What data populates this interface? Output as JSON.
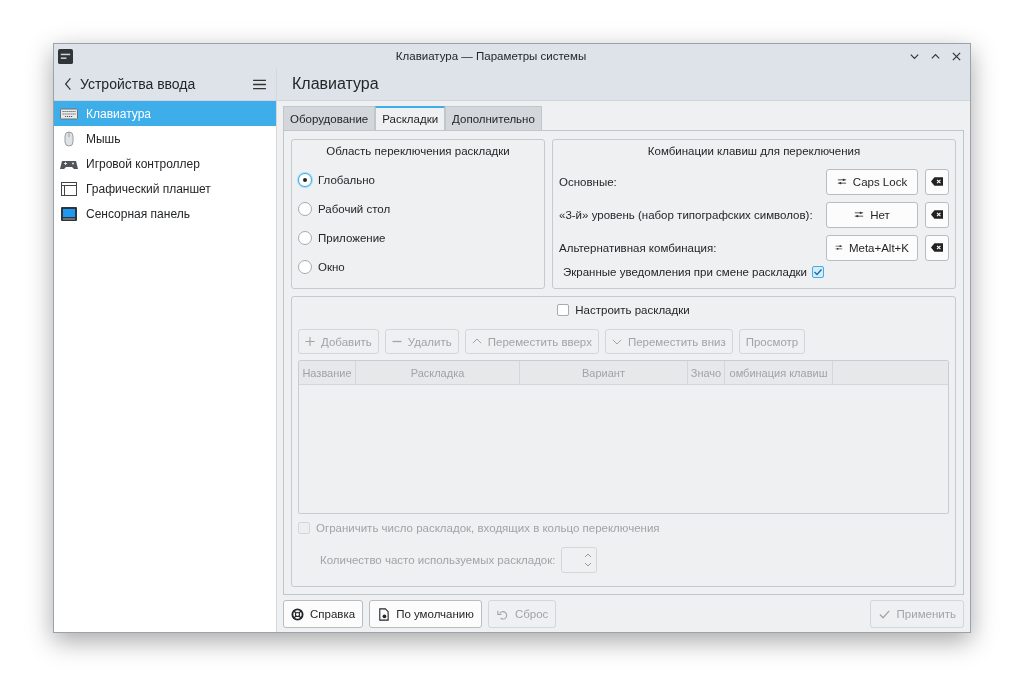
{
  "window": {
    "title": "Клавиатура — Параметры системы"
  },
  "sidebar": {
    "title": "Устройства ввода",
    "items": [
      {
        "label": "Клавиатура",
        "kind": "keyboard",
        "selected": true
      },
      {
        "label": "Мышь",
        "kind": "mouse",
        "selected": false
      },
      {
        "label": "Игровой контроллер",
        "kind": "gamepad",
        "selected": false
      },
      {
        "label": "Графический планшет",
        "kind": "tablet",
        "selected": false
      },
      {
        "label": "Сенсорная панель",
        "kind": "touchpad",
        "selected": false
      }
    ]
  },
  "page_title": "Клавиатура",
  "tabs": [
    {
      "label": "Оборудование",
      "selected": false
    },
    {
      "label": "Раскладки",
      "selected": true
    },
    {
      "label": "Дополнительно",
      "selected": false
    }
  ],
  "switching_area": {
    "title": "Область переключения раскладки",
    "options": [
      {
        "label": "Глобально",
        "selected": true
      },
      {
        "label": "Рабочий стол",
        "selected": false
      },
      {
        "label": "Приложение",
        "selected": false
      },
      {
        "label": "Окно",
        "selected": false
      }
    ]
  },
  "shortcuts": {
    "title": "Комбинации клавиш для переключения",
    "rows": [
      {
        "label": "Основные:",
        "value": "Caps Lock"
      },
      {
        "label": "«3-й» уровень (набор типографских символов):",
        "value": "Нет"
      },
      {
        "label": "Альтернативная комбинация:",
        "value": "Meta+Alt+K"
      }
    ],
    "osd": {
      "label": "Экранные уведомления при смене раскладки",
      "checked": true
    }
  },
  "layouts": {
    "configure": {
      "label": "Настроить раскладки",
      "checked": false
    },
    "buttons": [
      {
        "label": "Добавить",
        "kind": "plus",
        "disabled": true
      },
      {
        "label": "Удалить",
        "kind": "minus",
        "disabled": true
      },
      {
        "label": "Переместить вверх",
        "kind": "up",
        "disabled": true
      },
      {
        "label": "Переместить вниз",
        "kind": "down",
        "disabled": true
      },
      {
        "label": "Просмотр",
        "kind": "none",
        "disabled": true
      }
    ],
    "table": {
      "columns": [
        "Название",
        "Раскладка",
        "Вариант",
        "Значо",
        "омбинация клавиш"
      ]
    },
    "limit": {
      "label": "Ограничить число раскладок, входящих в кольцо переключения",
      "checked": false,
      "disabled": true
    },
    "count": {
      "label": "Количество часто используемых раскладок:",
      "disabled": true
    }
  },
  "footer": [
    {
      "label": "Справка",
      "kind": "help",
      "disabled": false
    },
    {
      "label": "По умолчанию",
      "kind": "defaults",
      "disabled": false
    },
    {
      "label": "Сброс",
      "kind": "reset",
      "disabled": true
    },
    {
      "label": "Применить",
      "kind": "apply",
      "disabled": true
    }
  ]
}
